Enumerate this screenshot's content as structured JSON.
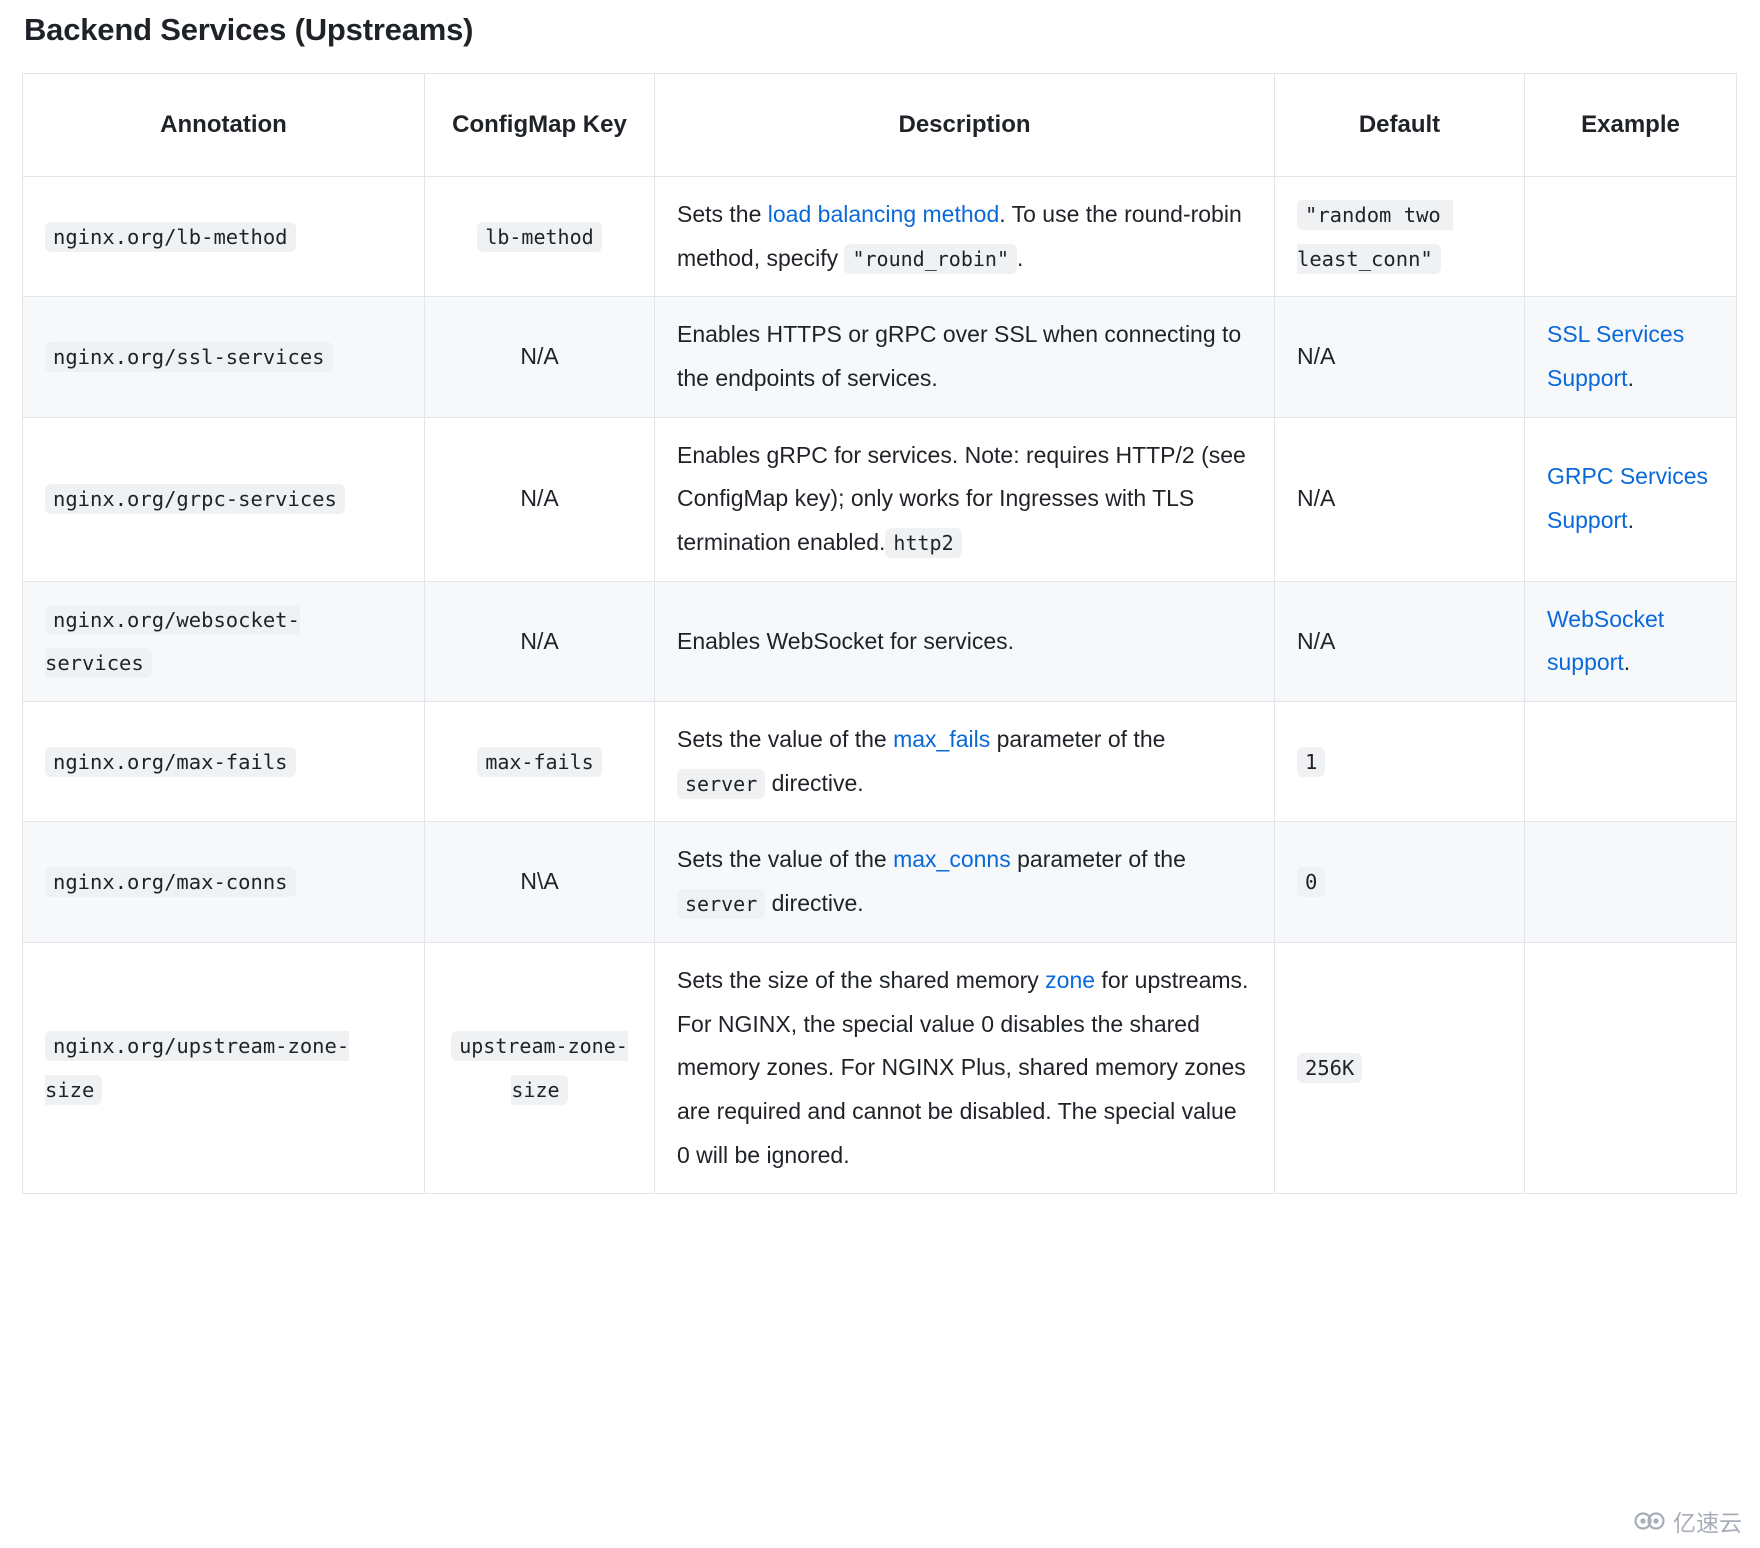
{
  "page_title": "Backend Services (Upstreams)",
  "colors": {
    "link": "#0969da",
    "code_bg": "#eff1f3",
    "row_stripe": "#f6f8fa",
    "border": "#e3e5e8",
    "text": "#1f2328"
  },
  "table": {
    "headers": {
      "annotation": "Annotation",
      "configmap_key": "ConfigMap Key",
      "description": "Description",
      "default": "Default",
      "example": "Example"
    },
    "rows": [
      {
        "annotation": "nginx.org/lb-method",
        "configmap_key": "lb-method",
        "description": {
          "p1": "Sets the ",
          "link1": "load balancing method",
          "p2": ". To use the round-robin method, specify ",
          "code1": "\"round_robin\"",
          "p3": "."
        },
        "default": "\"random two least_conn\"",
        "example": null
      },
      {
        "annotation": "nginx.org/ssl-services",
        "configmap_key": "N/A",
        "description": {
          "p1": "Enables HTTPS or gRPC over SSL when connecting to the endpoints of services."
        },
        "default": "N/A",
        "example": {
          "link": "SSL Services Support",
          "suffix": "."
        }
      },
      {
        "annotation": "nginx.org/grpc-services",
        "configmap_key": "N/A",
        "description": {
          "p1": "Enables gRPC for services. Note: requires HTTP/2 (see ",
          "code1": "http2",
          "p2": " ConfigMap key); only works for Ingresses with TLS termination enabled."
        },
        "default": "N/A",
        "example": {
          "link": "GRPC Services Support",
          "suffix": "."
        }
      },
      {
        "annotation": "nginx.org/websocket-services",
        "configmap_key": "N/A",
        "description": {
          "p1": "Enables WebSocket for services."
        },
        "default": "N/A",
        "example": {
          "link": "WebSocket support",
          "suffix": "."
        }
      },
      {
        "annotation": "nginx.org/max-fails",
        "configmap_key": "max-fails",
        "description": {
          "p1": "Sets the value of the ",
          "link1": "max_fails",
          "p2": " parameter of the ",
          "code1": "server",
          "p3": " directive."
        },
        "default": "1",
        "example": null
      },
      {
        "annotation": "nginx.org/max-conns",
        "configmap_key": "N\\A",
        "description": {
          "p1": "Sets the value of the ",
          "link1": "max_conns",
          "p2": " parameter of the ",
          "code1": "server",
          "p3": " directive."
        },
        "default": "0",
        "example": null
      },
      {
        "annotation": "nginx.org/upstream-zone-size",
        "configmap_key": "upstream-zone-size",
        "description": {
          "p1": "Sets the size of the shared memory ",
          "link1": "zone",
          "p2": " for upstreams. For NGINX, the special value 0 disables the shared memory zones. For NGINX Plus, shared memory zones are required and cannot be disabled. The special value 0 will be ignored."
        },
        "default": "256K",
        "example": null
      }
    ]
  },
  "watermark": {
    "text": "亿速云",
    "icon": "cloud-icon"
  }
}
